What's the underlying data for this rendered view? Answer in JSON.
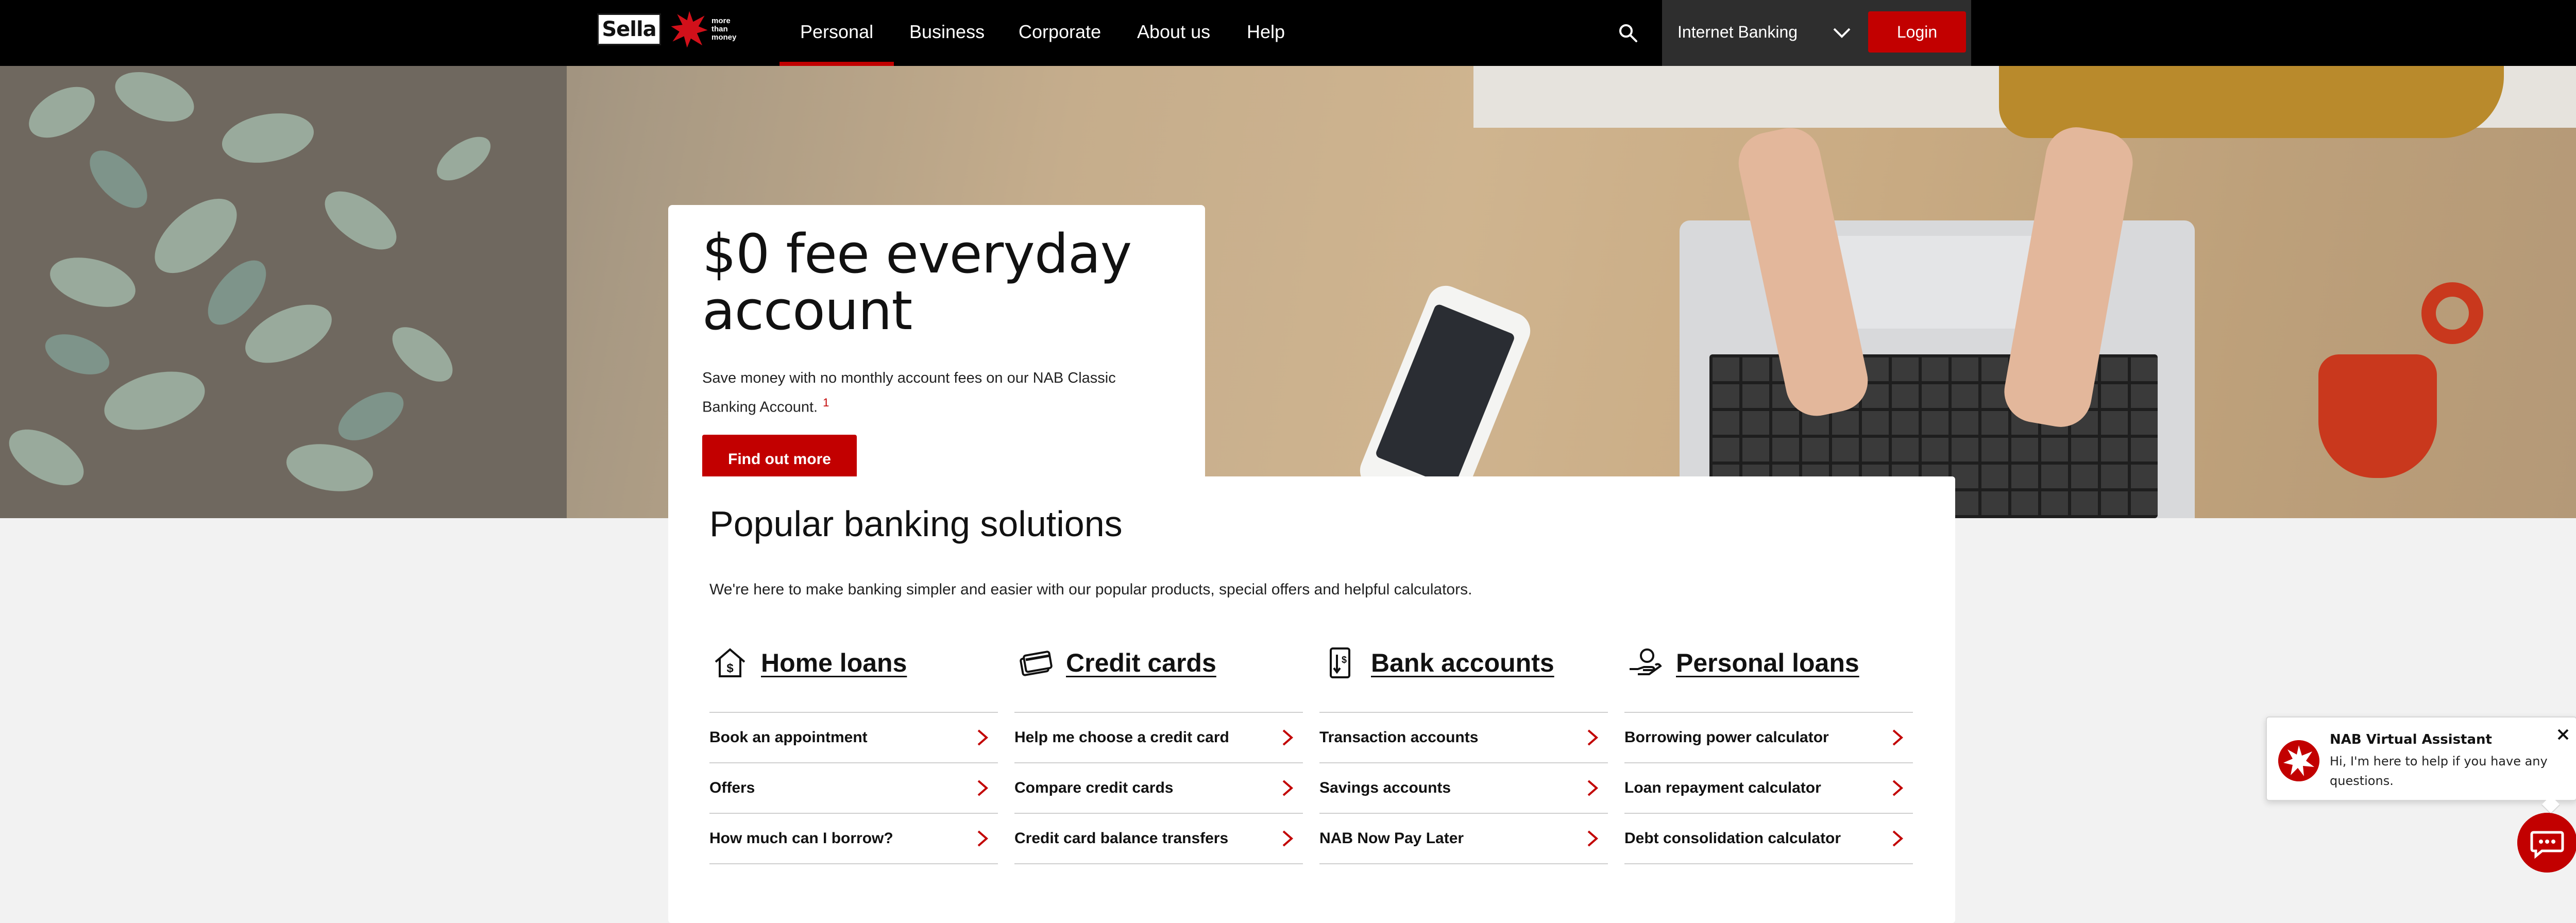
{
  "header": {
    "logo_text": "Sella",
    "tagline": "more than money",
    "nav": [
      "Personal",
      "Business",
      "Corporate",
      "About us",
      "Help"
    ],
    "active_nav": "Personal",
    "internet_banking": "Internet Banking",
    "login": "Login"
  },
  "hero": {
    "title": "$0 fee everyday account",
    "body": "Save money with no monthly account fees on our NAB Classic Banking Account.",
    "footnote": "1",
    "cta": "Find out more"
  },
  "popular": {
    "title": "Popular banking solutions",
    "intro": "We're here to make banking simpler and easier with our popular products, special offers and helpful calculators.",
    "columns": [
      {
        "title": "Home loans",
        "icon": "house-dollar-icon",
        "links": [
          "Book an appointment",
          "Offers",
          "How much can I borrow?"
        ]
      },
      {
        "title": "Credit cards",
        "icon": "credit-card-icon",
        "links": [
          "Help me choose a credit card",
          "Compare credit cards",
          "Credit card balance transfers"
        ]
      },
      {
        "title": "Bank accounts",
        "icon": "bank-transfer-icon",
        "links": [
          "Transaction accounts",
          "Savings accounts",
          "NAB Now Pay Later"
        ]
      },
      {
        "title": "Personal loans",
        "icon": "hand-coin-icon",
        "links": [
          "Borrowing power calculator",
          "Loan repayment calculator",
          "Debt consolidation calculator"
        ]
      }
    ]
  },
  "chat": {
    "title": "NAB Virtual Assistant",
    "message": "Hi, I'm here to help if you have any questions."
  },
  "colors": {
    "brand_red": "#c20000",
    "nav_bg": "#000000",
    "ib_bg": "#2e2e2e"
  }
}
